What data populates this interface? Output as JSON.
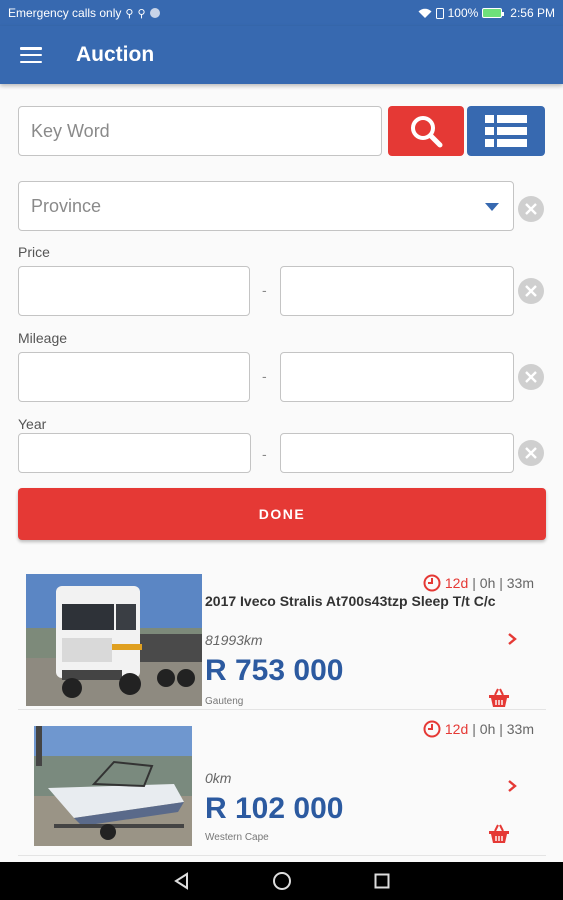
{
  "status_bar": {
    "carrier_text": "Emergency calls only",
    "battery": "100%",
    "time": "2:56 PM"
  },
  "app_bar": {
    "title": "Auction",
    "menu_icon": "hamburger-menu-icon"
  },
  "search": {
    "keyword_placeholder": "Key Word",
    "search_icon": "search-icon",
    "list_view_icon": "list-view-icon"
  },
  "filters": {
    "province_placeholder": "Province",
    "price_label": "Price",
    "mileage_label": "Mileage",
    "year_label": "Year",
    "range_separator": "-",
    "clear_icon": "clear-circle-icon"
  },
  "done_button": "DONE",
  "listings": [
    {
      "days": "12d",
      "time_rest": "| 0h | 33m",
      "title": "2017 Iveco Stralis At700s43tzp Sleep T/t C/c",
      "mileage": "81993km",
      "price": "R 753 000",
      "region": "Gauteng",
      "image": "white-truck-photo"
    },
    {
      "days": "12d",
      "time_rest": "| 0h | 33m",
      "title": "",
      "mileage": "0km",
      "price": "R 102 000",
      "region": "Western Cape",
      "image": "boat-on-trailer-photo"
    }
  ],
  "colors": {
    "primary_blue": "#3769b0",
    "accent_red": "#e53935",
    "price_blue": "#2c5aa0"
  },
  "nav_bar": {
    "back_icon": "back-triangle-icon",
    "home_icon": "home-circle-icon",
    "recents_icon": "recents-square-icon"
  }
}
